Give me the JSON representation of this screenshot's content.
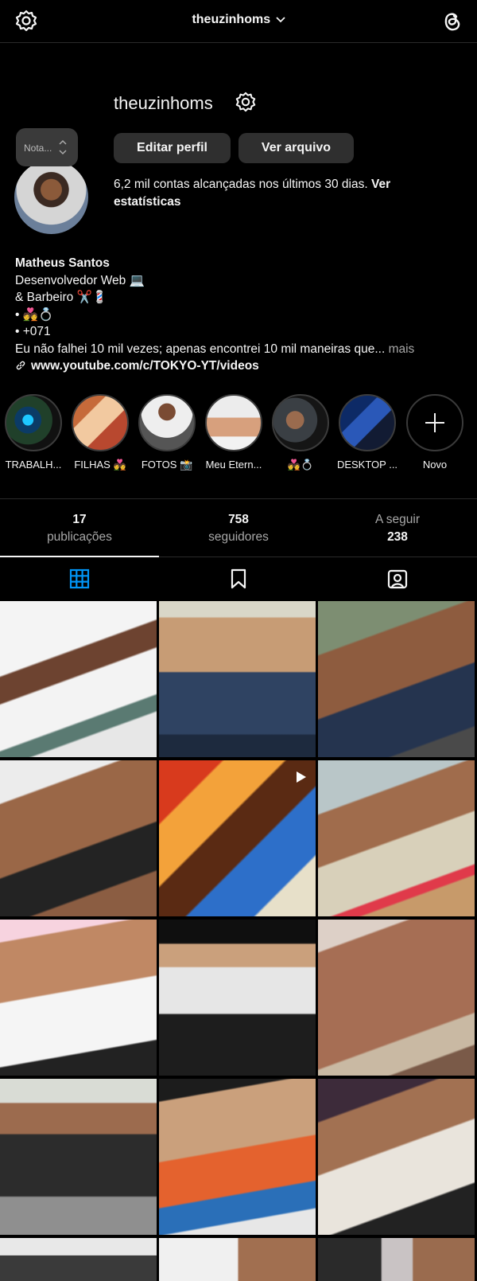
{
  "topbar": {
    "username": "theuzinhoms",
    "chevron": "chevron-down-icon",
    "settings_icon": "settings-icon",
    "threads_icon": "threads-icon"
  },
  "profile": {
    "username": "theuzinhoms",
    "edit_label": "Editar perfil",
    "archive_label": "Ver arquivo",
    "reach_text": "6,2 mil contas alcançadas nos últimos 30 dias.",
    "reach_link": "Ver estatísticas",
    "note_placeholder": "Nota..."
  },
  "bio": {
    "name": "Matheus Santos",
    "line1": "Desenvolvedor Web 💻",
    "line2": "& Barbeiro ✂️💈",
    "line3": "• 💑💍",
    "line4": "• +071",
    "line5": "Eu não falhei 10 mil vezes; apenas encontrei 10 mil maneiras que...",
    "more": "mais",
    "link": "www.youtube.com/c/TOKYO-YT/videos"
  },
  "highlights": [
    {
      "label": "TRABALH..."
    },
    {
      "label": "FILHAS 💑"
    },
    {
      "label": "FOTOS 📸"
    },
    {
      "label": "Meu Etern..."
    },
    {
      "label": "💑💍"
    },
    {
      "label": "DESKTOP ..."
    },
    {
      "label": "Novo"
    }
  ],
  "stats": {
    "posts_num": "17",
    "posts_label": "publicações",
    "followers_num": "758",
    "followers_label": "seguidores",
    "following_label": "A seguir",
    "following_num": "238"
  },
  "colors": {
    "background": "#000000",
    "button": "#2f2f2f",
    "accent": "#0095f6",
    "muted": "#a8a8a8"
  }
}
